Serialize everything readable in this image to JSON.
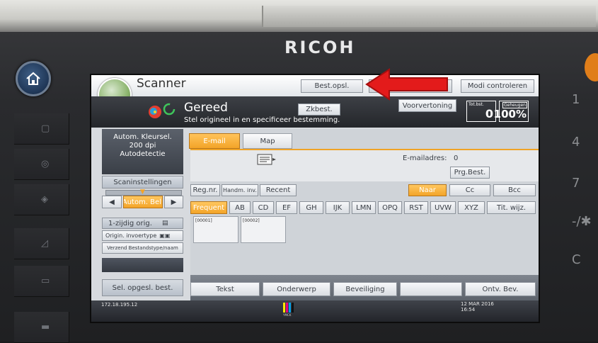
{
  "device": {
    "brand": "RICOH"
  },
  "app": {
    "title": "Scanner",
    "header_buttons": {
      "saved_file": "Best.opsl.",
      "check_modes": "Modi controleren"
    }
  },
  "status": {
    "ready_label": "Gereed",
    "instruction": "Stel origineel in en specificeer bestemming.",
    "search_button": "Zkbest.",
    "preview_button": "Voorvertoning",
    "total_label": "Tot.bst.",
    "total_value": "0",
    "memory_label": "Geheugen",
    "memory_value": "100%"
  },
  "left_panel": {
    "settings_line1": "Autom. Kleursel.",
    "settings_line2": "200 dpi",
    "settings_line3": "Autodetectie",
    "scan_settings": "Scaninstellingen",
    "color_mode": "Autom. Bel.",
    "original_sides": "1-zijdig orig.",
    "original_orientation": "Origin. invoertype",
    "send_file_type": "Verzend Bestandstype/naam",
    "select_stored_file": "Sel. opgesl. best."
  },
  "tabs": [
    {
      "label": "E-mail",
      "active": true
    },
    {
      "label": "Map",
      "active": false
    }
  ],
  "destination": {
    "email_address_label": "E-mailadres:",
    "email_address_count": "0",
    "program_dest": "Prg.Best.",
    "reg_no": "Reg.nr.",
    "manual_entry": "Handm. inv.",
    "recent": "Recent",
    "to": "Naar",
    "cc": "Cc",
    "bcc": "Bcc",
    "index_tabs": [
      "Frequent",
      "AB",
      "CD",
      "EF",
      "GH",
      "IJK",
      "LMN",
      "OPQ",
      "RST",
      "UVW",
      "XYZ",
      "Tit. wijz."
    ],
    "cards": [
      "[00001]",
      "[00002]"
    ]
  },
  "bottom_tabs": {
    "text": "Tekst",
    "subject": "Onderwerp",
    "security": "Beveiliging",
    "receipt": "Ontv. Bev."
  },
  "footer": {
    "ip": "172.18.195.12",
    "date": "12 MAR  2016",
    "time": "16:54"
  },
  "colors": {
    "accent": "#f3a428",
    "arrow": "#e31b1b",
    "status_bar": "#2f3237"
  }
}
